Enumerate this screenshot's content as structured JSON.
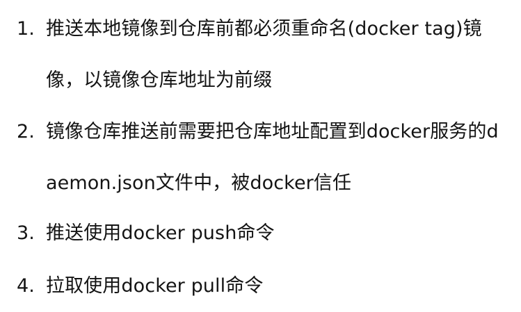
{
  "document": {
    "items": [
      {
        "number": "1.",
        "text": "推送本地镜像到仓库前都必须重命名(docker tag)镜像，以镜像仓库地址为前缀"
      },
      {
        "number": "2.",
        "text": "镜像仓库推送前需要把仓库地址配置到docker服务的daemon.json文件中，被docker信任"
      },
      {
        "number": "3.",
        "text": "推送使用docker push命令"
      },
      {
        "number": "4.",
        "text": "拉取使用docker pull命令"
      }
    ]
  }
}
